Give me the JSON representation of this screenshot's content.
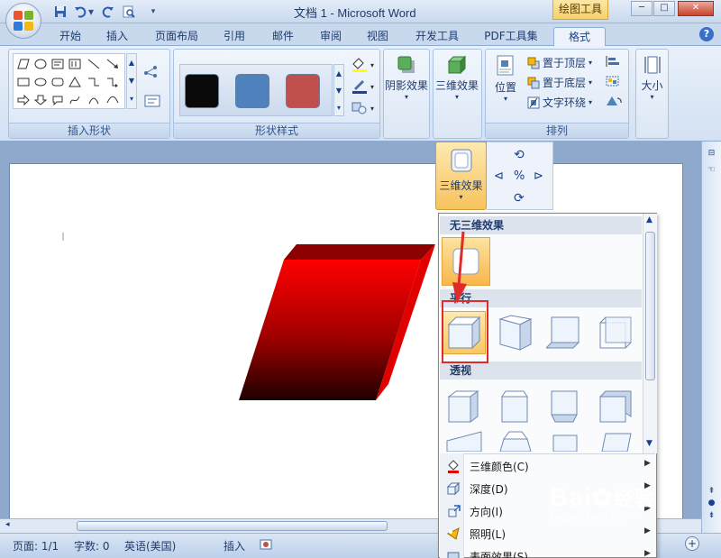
{
  "window": {
    "title": "文档 1 - Microsoft Word",
    "context_tab": "绘图工具",
    "buttons": {
      "minimize": "─",
      "maximize": "□",
      "close": "✕"
    }
  },
  "quick_access": [
    "save-icon",
    "undo-icon",
    "redo-icon",
    "print-preview-icon",
    "customize-icon"
  ],
  "tabs": [
    "开始",
    "插入",
    "页面布局",
    "引用",
    "邮件",
    "审阅",
    "视图",
    "开发工具",
    "PDF工具集",
    "格式"
  ],
  "active_tab": "格式",
  "ribbon": {
    "groups": {
      "insert_shapes": {
        "label": "插入形状"
      },
      "shape_styles": {
        "label": "形状样式",
        "swatches": [
          "#0a0a0a",
          "#4f81bd",
          "#c0504d"
        ]
      },
      "shadow": {
        "label": "阴影效果"
      },
      "threed": {
        "label": "三维效果"
      },
      "arrange": {
        "label": "排列",
        "position": "位置",
        "bring_front": "置于顶层",
        "send_back": "置于底层",
        "text_wrap": "文字环绕"
      },
      "size": {
        "label": "大小"
      }
    }
  },
  "dropdown": {
    "button_label": "三维效果",
    "section_none": "无三维效果",
    "section_parallel": "平行",
    "section_perspective": "透视",
    "menu_items": [
      {
        "label": "三维颜色(C)",
        "icon": "paint-bucket-icon"
      },
      {
        "label": "深度(D)",
        "icon": "depth-icon"
      },
      {
        "label": "方向(I)",
        "icon": "direction-icon"
      },
      {
        "label": "照明(L)",
        "icon": "lighting-icon"
      },
      {
        "label": "表面效果(S)",
        "icon": "surface-icon"
      }
    ]
  },
  "status": {
    "page": "页面: 1/1",
    "words": "字数: 0",
    "language": "英语(美国)",
    "mode": "插入"
  },
  "shape_color": "#ee0000",
  "watermark": {
    "brand": "Bai",
    "brand2": "经验",
    "url": "jingyan.baidu.com"
  }
}
